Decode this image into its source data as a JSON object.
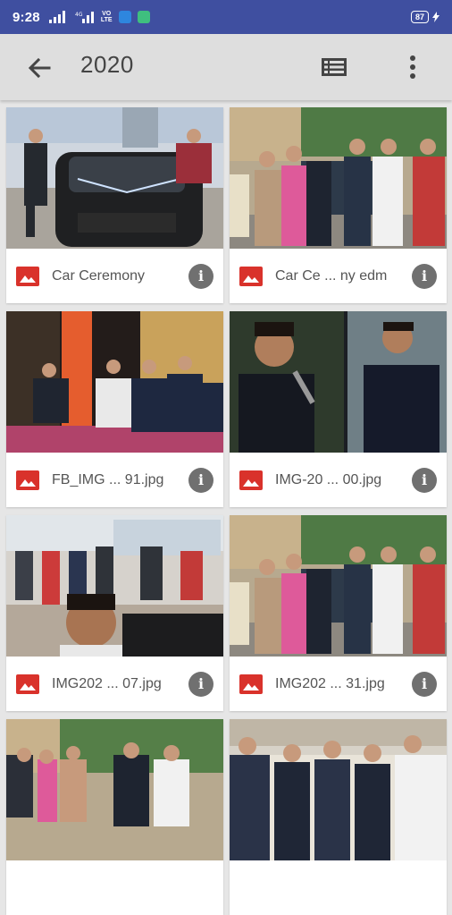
{
  "status_bar": {
    "time": "9:28",
    "network_label": "VO LTE",
    "battery": "87"
  },
  "app_bar": {
    "title": "2020",
    "back_icon": "arrow-back-icon",
    "view_icon": "list-view-icon",
    "menu_icon": "more-vert-icon"
  },
  "colors": {
    "status_bar": "#3f4fa0",
    "app_bar": "#dedede",
    "image_icon": "#d9322b",
    "info_icon": "#707070"
  },
  "items": [
    {
      "name": "Car Ceremony"
    },
    {
      "name": "Car Ce ... ny edm"
    },
    {
      "name": "FB_IMG ... 91.jpg"
    },
    {
      "name": "IMG-20 ... 00.jpg"
    },
    {
      "name": "IMG202 ... 07.jpg"
    },
    {
      "name": "IMG202 ... 31.jpg"
    },
    {
      "name": ""
    },
    {
      "name": ""
    }
  ]
}
